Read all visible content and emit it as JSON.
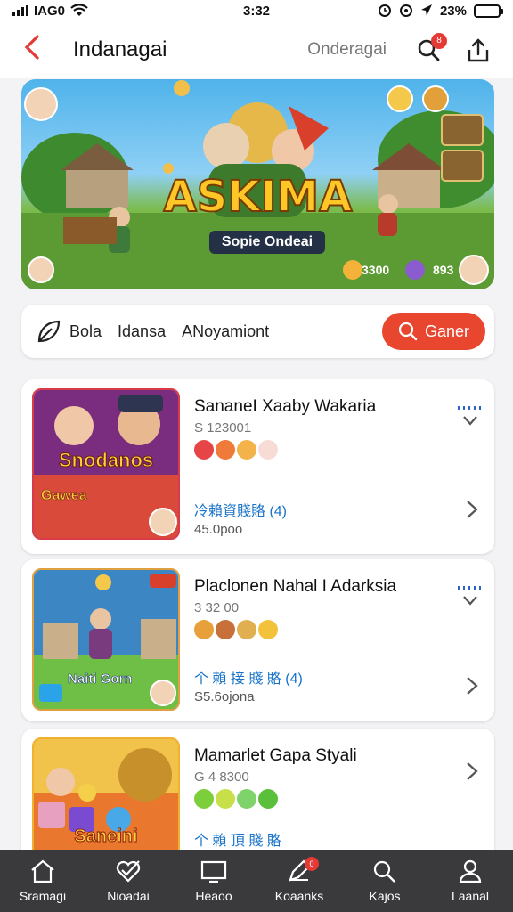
{
  "status": {
    "carrier": "IAG0",
    "time": "3:32",
    "battery": "23%",
    "battery_level": 0.23
  },
  "header": {
    "title": "Indanagai",
    "link": "Onderagai",
    "notification_count": "8"
  },
  "banner": {
    "tag": "",
    "title": "ASKIMA",
    "subtitle": "Sopie Ondeai",
    "count_a": "3300",
    "count_b": "893"
  },
  "filter": {
    "options": [
      "Bola",
      "Idansa",
      "ANoyamiont"
    ],
    "button_label": "Ganer"
  },
  "games": [
    {
      "title": "SananeI Xaaby Wakaria",
      "code": "S 123001",
      "dots": [
        "#e64545",
        "#f07a3a",
        "#f4b24a",
        "#f6dcd4"
      ],
      "info": "冷賴資賤賂 (4)",
      "size": "45.0poo",
      "thumb_title": "Snodanos",
      "thumb_sub": "Gawea",
      "thumb_colors": [
        "#7a2c7e",
        "#d94a3a"
      ]
    },
    {
      "title": "Placlonen Nahal I Adarksia",
      "code": "3 32 00",
      "dots": [
        "#e8a03a",
        "#c8703a",
        "#e0b050",
        "#f4c23a"
      ],
      "info": "个 賴 接 賤 賂 (4)",
      "size": "S5.6ojona",
      "thumb_title": "Naiti Gorn",
      "thumb_sub": "",
      "thumb_colors": [
        "#3d86c4",
        "#6fbf47"
      ]
    },
    {
      "title": "Mamarlet Gapa Styali",
      "code": "G 4 8300",
      "dots": [
        "#7ccf3a",
        "#c7e04a",
        "#7ed36a",
        "#5abf3a"
      ],
      "info": "个 賴 頂 賤 賂 ",
      "size": "",
      "thumb_title": "Saneini",
      "thumb_sub": "",
      "thumb_colors": [
        "#e9772d",
        "#f1c34a"
      ]
    }
  ],
  "tabs": [
    {
      "label": "Sramagi",
      "icon": "home-icon"
    },
    {
      "label": "Nioadai",
      "icon": "heart-check-icon"
    },
    {
      "label": "Heaoo",
      "icon": "monitor-icon"
    },
    {
      "label": "Koaanks",
      "icon": "pen-icon",
      "badge": "0"
    },
    {
      "label": "Kajos",
      "icon": "search-icon"
    },
    {
      "label": "Laanal",
      "icon": "user-icon"
    }
  ]
}
